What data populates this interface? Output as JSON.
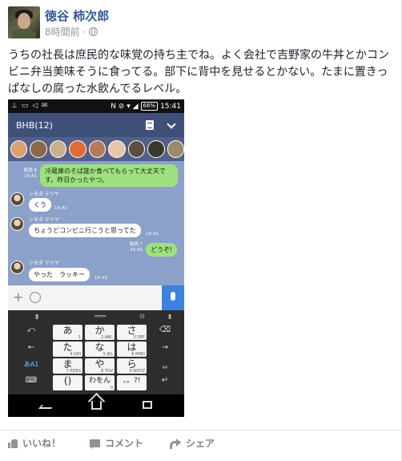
{
  "post": {
    "author": "徳谷 柿次郎",
    "time": "8時間前",
    "separator": "·",
    "text": "うちの社長は庶民的な味覚の持ち主でね。よく会社で吉野家の牛丼とかコンビニ弁当美味そうに食ってる。部下に背中を見せるとかない。たまに置きっぱなしの腐った水飲んでるレベル。"
  },
  "phone": {
    "status_left": "⊥ ▭ ◁ ✉",
    "status_icons": "N ⊘ ▾ ◢",
    "battery": "66%",
    "clock": "15:41",
    "chat_title": "BHB(12)",
    "messages": [
      {
        "sender": "",
        "read": "既読 8",
        "time": "15:41",
        "text": "冷蔵庫のそば誰か食べてもらって大丈夫です。昨日かったやつ。",
        "side": "out"
      },
      {
        "sender": "シモダ テツヤ",
        "read": "",
        "time": "15:41",
        "text": "くう",
        "side": "in"
      },
      {
        "sender": "シモダ テツヤ",
        "read": "",
        "time": "15:41",
        "text": "ちょうどコンビニ行こうと思ってた",
        "side": "in"
      },
      {
        "sender": "",
        "read": "既読 7",
        "time": "15:41",
        "text": "どうぞ!",
        "side": "out"
      },
      {
        "sender": "シモダ テツヤ",
        "read": "",
        "time": "15:41",
        "text": "やった　ラッキー",
        "side": "in"
      }
    ],
    "keyboard": {
      "rows": [
        [
          {
            "main": "あ",
            "sub": "1"
          },
          {
            "main": "か",
            "sub": "2 ABC"
          },
          {
            "main": "さ",
            "sub": "3 DEF"
          }
        ],
        [
          {
            "main": "た",
            "sub": "4 GHI"
          },
          {
            "main": "な",
            "sub": "5 JKL"
          },
          {
            "main": "は",
            "sub": "6 MNO"
          }
        ],
        [
          {
            "main": "ま",
            "sub": "7 PQRS"
          },
          {
            "main": "や",
            "sub": "8 TUV"
          },
          {
            "main": "ら",
            "sub": "9 WXYZ"
          }
        ],
        [
          {
            "main": "()",
            "sub": ""
          },
          {
            "main": "わをん",
            "sub": "0"
          },
          {
            "main": "、。?!",
            "sub": ""
          }
        ]
      ],
      "left_keys": [
        "⤺",
        "←",
        "あA1",
        "⌨"
      ],
      "right_keys": [
        "⌫",
        "→",
        "␣",
        "↵"
      ]
    }
  },
  "actions": {
    "like": "いいね！",
    "comment": "コメント",
    "share": "シェア"
  },
  "colors": {
    "author_link": "#365899",
    "chat_header": "#3f5078",
    "chat_background": "#8ba1c9",
    "out_bubble": "#9de27e",
    "mic_button": "#3d82dc"
  }
}
